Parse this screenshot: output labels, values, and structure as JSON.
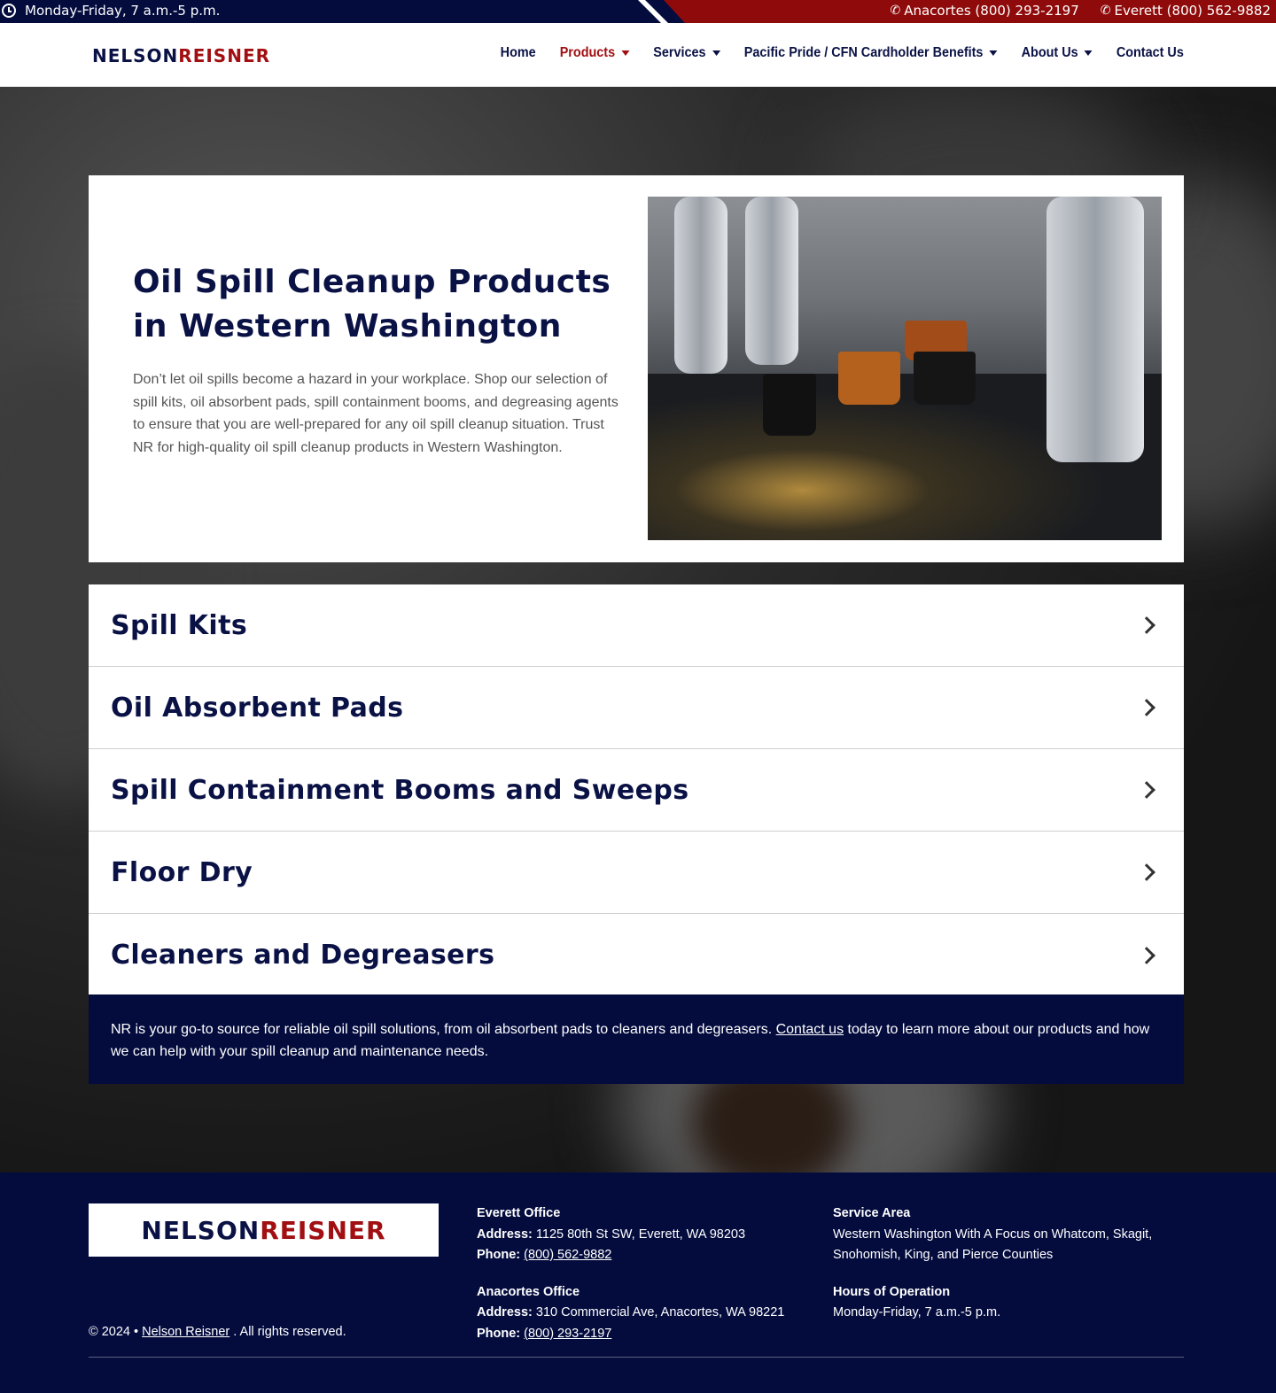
{
  "topbar": {
    "hours": "Monday-Friday, 7 a.m.-5 p.m.",
    "phones": [
      {
        "label": "Anacortes (800) 293-2197"
      },
      {
        "label": "Everett (800) 562-9882"
      }
    ]
  },
  "header": {
    "logo": {
      "part1": "NELSON",
      "part2": "REISNER"
    },
    "nav": [
      {
        "label": "Home",
        "dropdown": false,
        "active": false
      },
      {
        "label": "Products",
        "dropdown": true,
        "active": true
      },
      {
        "label": "Services",
        "dropdown": true,
        "active": false
      },
      {
        "label": "Pacific Pride / CFN Cardholder Benefits",
        "dropdown": true,
        "active": false
      },
      {
        "label": "About Us",
        "dropdown": true,
        "active": false
      },
      {
        "label": "Contact Us",
        "dropdown": false,
        "active": false
      }
    ]
  },
  "intro": {
    "title": "Oil Spill Cleanup Products in Western Washington",
    "body": "Don’t let oil spills become a hazard in your workplace. Shop our selection of spill kits, oil absorbent pads, spill containment booms, and degreasing agents to ensure that you are well-prepared for any oil spill cleanup situation. Trust NR for high-quality oil spill cleanup products in Western Washington."
  },
  "accordion": [
    {
      "title": "Spill Kits"
    },
    {
      "title": "Oil Absorbent Pads"
    },
    {
      "title": "Spill Containment Booms and Sweeps"
    },
    {
      "title": "Floor Dry"
    },
    {
      "title": "Cleaners and Degreasers"
    }
  ],
  "cta": {
    "before": "NR is your go-to source for reliable oil spill solutions, from oil absorbent pads to cleaners and degreasers. ",
    "link": "Contact us",
    "after": " today to learn more about our products and how we can help with your spill cleanup and maintenance needs."
  },
  "footer": {
    "logo": {
      "part1": "NELSON",
      "part2": "REISNER"
    },
    "copyright": {
      "prefix": "© 2024 • ",
      "link": "Nelson Reisner",
      "suffix": " . All rights reserved."
    },
    "everett": {
      "heading": "Everett Office",
      "address_label": "Address:",
      "address": " 1125 80th St SW, Everett, WA 98203",
      "phone_label": "Phone:",
      "phone": "(800) 562-9882"
    },
    "anacortes": {
      "heading": "Anacortes Office",
      "address_label": "Address:",
      "address": " 310 Commercial Ave, Anacortes, WA 98221",
      "phone_label": "Phone:",
      "phone": "(800) 293-2197"
    },
    "service_area": {
      "heading": "Service Area",
      "text": "Western Washington With A Focus on Whatcom, Skagit, Snohomish, King, and Pierce Counties"
    },
    "hours": {
      "heading": "Hours of Operation",
      "text": "Monday-Friday, 7 a.m.-5 p.m."
    }
  },
  "colors": {
    "navy": "#040c3e",
    "brand_red": "#a10f12",
    "topbar_red": "#8f0b0b"
  }
}
